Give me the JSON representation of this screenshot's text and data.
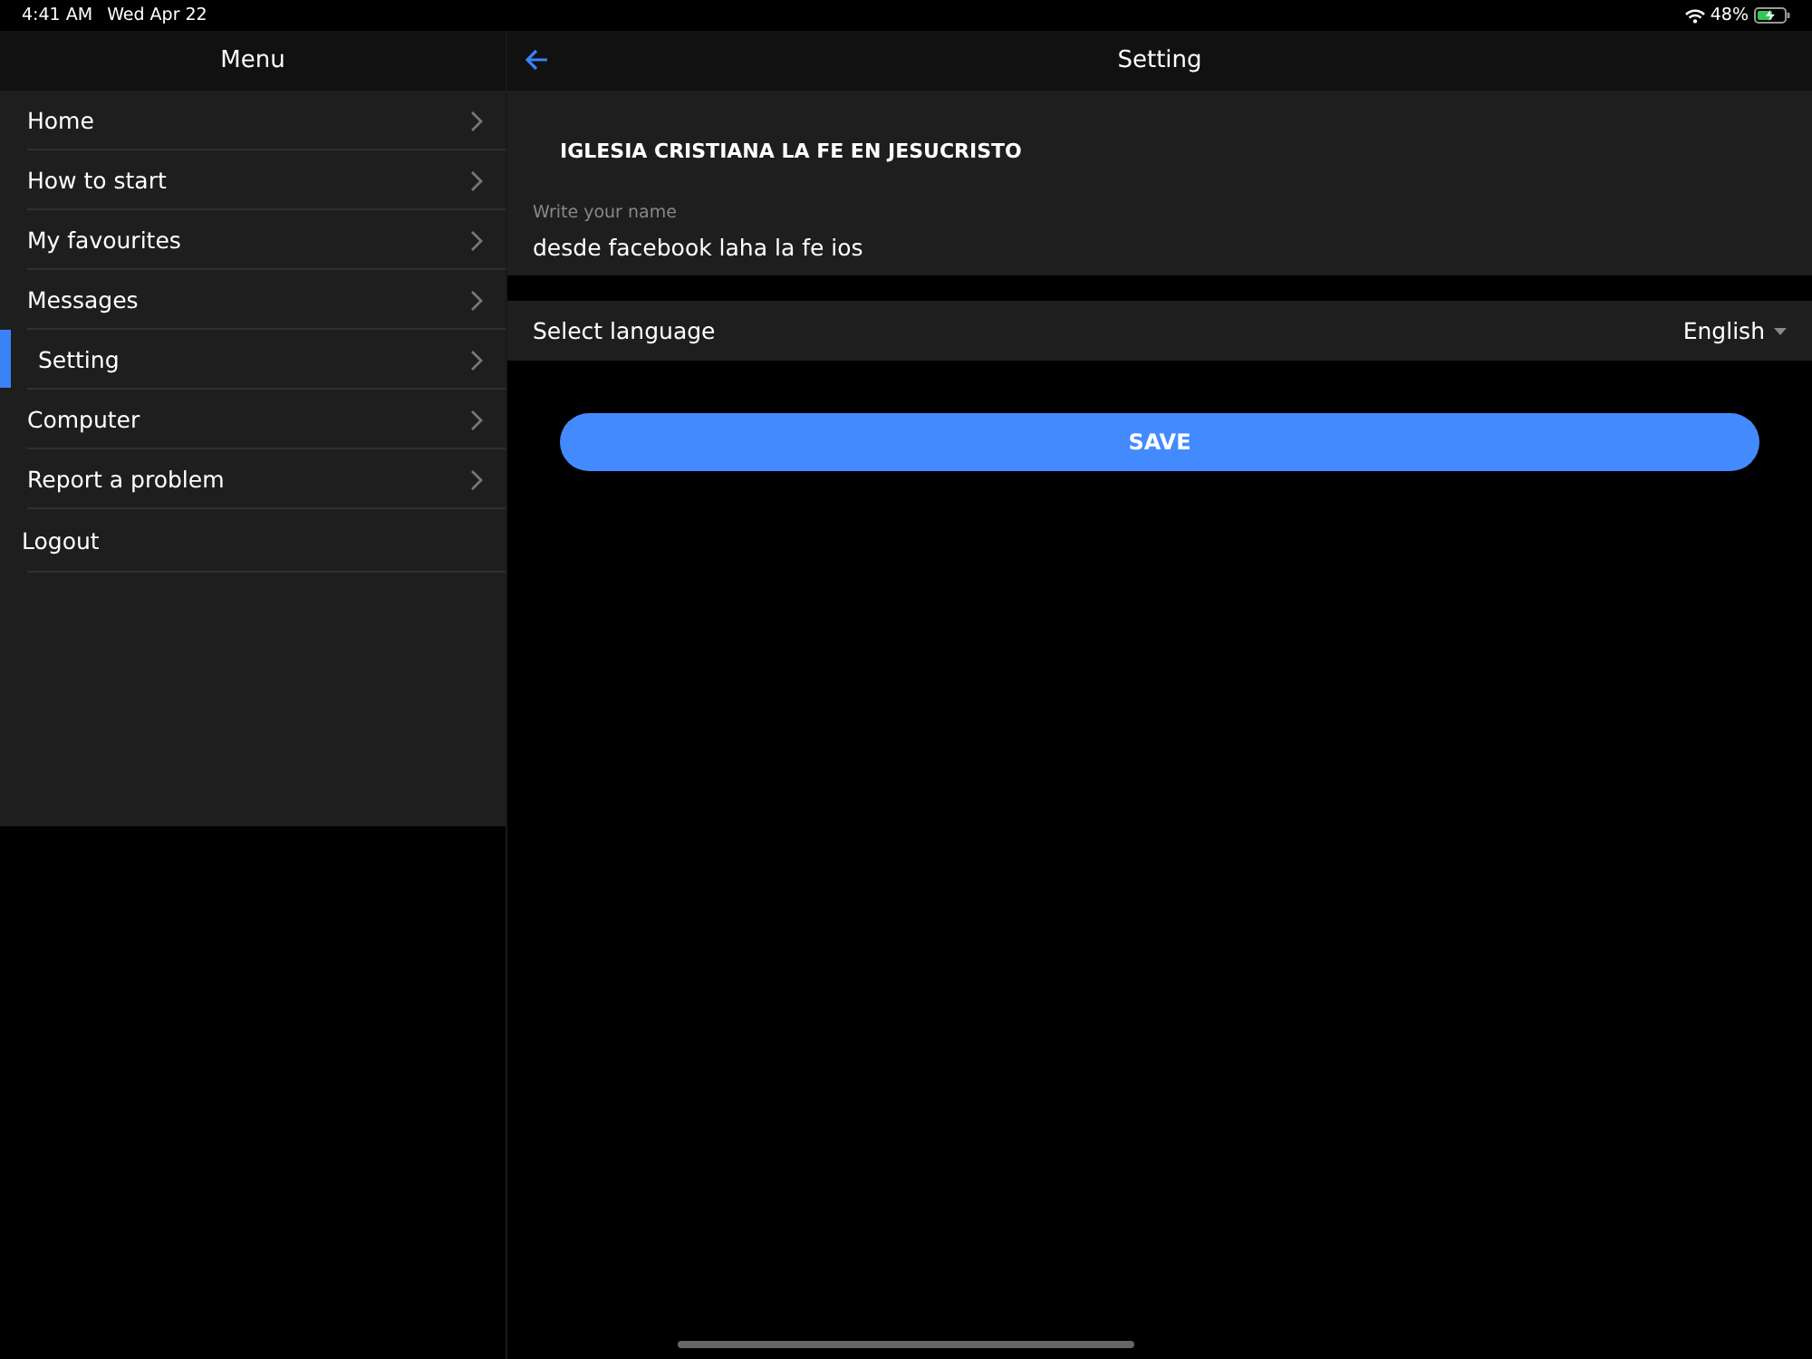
{
  "status_bar": {
    "time": "4:41 AM",
    "date": "Wed Apr 22",
    "battery": "48%"
  },
  "sidebar": {
    "title": "Menu",
    "items": [
      {
        "label": "Home",
        "kind": "link",
        "selected": false
      },
      {
        "label": "How to start",
        "kind": "link",
        "selected": false
      },
      {
        "label": "My favourites",
        "kind": "link",
        "selected": false
      },
      {
        "label": "Messages",
        "kind": "link",
        "selected": false
      },
      {
        "label": "Setting",
        "kind": "link",
        "selected": true
      },
      {
        "label": "Computer",
        "kind": "link",
        "selected": false
      },
      {
        "label": "Report a problem",
        "kind": "link",
        "selected": false
      },
      {
        "label": "Logout",
        "kind": "action",
        "selected": false
      }
    ]
  },
  "page": {
    "title": "Setting",
    "organization": "IGLESIA CRISTIANA LA FE EN JESUCRISTO",
    "name_field": {
      "label": "Write your name",
      "value": "desde facebook laha la fe ios"
    },
    "language": {
      "label": "Select language",
      "value": "English"
    },
    "save_button": "SAVE"
  }
}
